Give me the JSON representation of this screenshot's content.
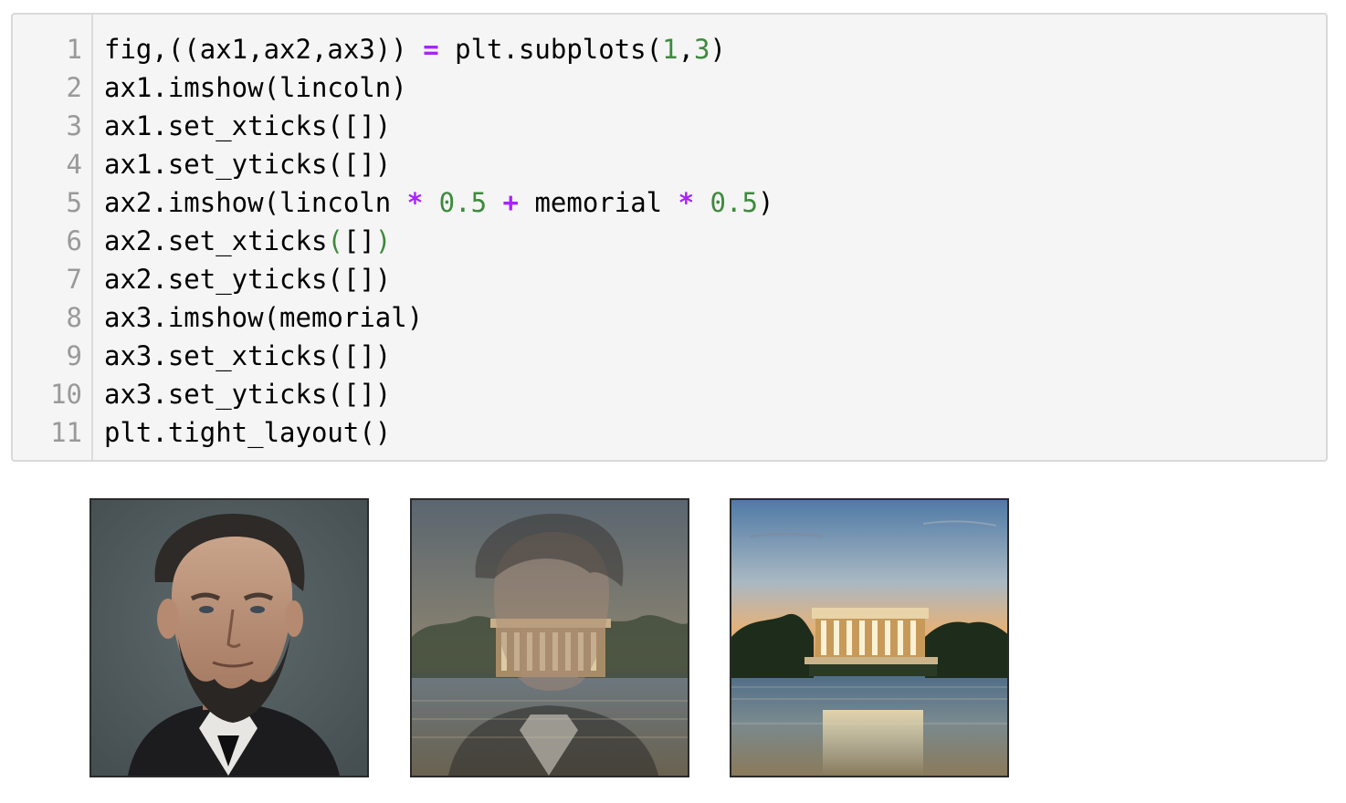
{
  "code_cell": {
    "line_numbers": [
      "1",
      "2",
      "3",
      "4",
      "5",
      "6",
      "7",
      "8",
      "9",
      "10",
      "11"
    ],
    "lines": [
      [
        {
          "t": "fig,((ax1,ax2,ax3)) ",
          "c": ""
        },
        {
          "t": "=",
          "c": "op"
        },
        {
          "t": " plt.subplots(",
          "c": ""
        },
        {
          "t": "1",
          "c": "num"
        },
        {
          "t": ",",
          "c": ""
        },
        {
          "t": "3",
          "c": "num"
        },
        {
          "t": ")",
          "c": ""
        }
      ],
      [
        {
          "t": "ax1.imshow(lincoln)",
          "c": ""
        }
      ],
      [
        {
          "t": "ax1.set_xticks([])",
          "c": ""
        }
      ],
      [
        {
          "t": "ax1.set_yticks([])",
          "c": ""
        }
      ],
      [
        {
          "t": "ax2.imshow(lincoln ",
          "c": ""
        },
        {
          "t": "*",
          "c": "op"
        },
        {
          "t": " ",
          "c": ""
        },
        {
          "t": "0.5",
          "c": "num"
        },
        {
          "t": " ",
          "c": ""
        },
        {
          "t": "+",
          "c": "op"
        },
        {
          "t": " memorial ",
          "c": ""
        },
        {
          "t": "*",
          "c": "op"
        },
        {
          "t": " ",
          "c": ""
        },
        {
          "t": "0.5",
          "c": "num"
        },
        {
          "t": ")",
          "c": ""
        }
      ],
      [
        {
          "t": "ax2.set_xticks",
          "c": ""
        },
        {
          "t": "(",
          "c": "paren"
        },
        {
          "t": "[]",
          "c": ""
        },
        {
          "t": ")",
          "c": "paren"
        }
      ],
      [
        {
          "t": "ax2.set_yticks([])",
          "c": ""
        }
      ],
      [
        {
          "t": "ax3.imshow(memorial)",
          "c": ""
        }
      ],
      [
        {
          "t": "ax3.set_xticks([])",
          "c": ""
        }
      ],
      [
        {
          "t": "ax3.set_yticks([])",
          "c": ""
        }
      ],
      [
        {
          "t": "plt.tight_layout()",
          "c": ""
        }
      ]
    ]
  },
  "output": {
    "images": [
      {
        "name": "lincoln-portrait-image"
      },
      {
        "name": "blended-image"
      },
      {
        "name": "memorial-image"
      }
    ]
  },
  "colors": {
    "operator": "#aa22ff",
    "number": "#3d8a3d",
    "text": "#000000",
    "line_number": "#999999",
    "cell_background": "#f5f5f5"
  }
}
